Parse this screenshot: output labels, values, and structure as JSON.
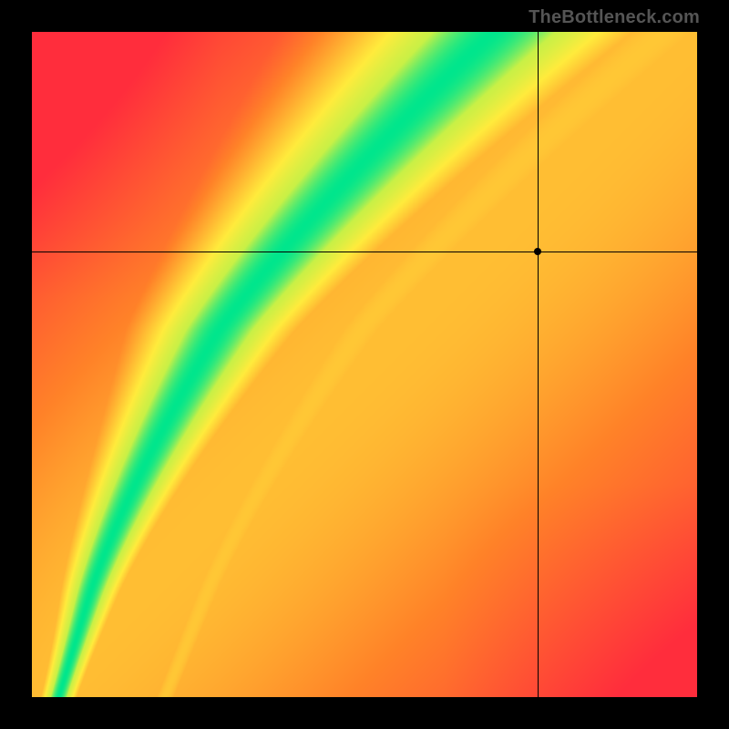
{
  "watermark": "TheBottleneck.com",
  "chart_data": {
    "type": "heatmap",
    "title": "",
    "xlabel": "",
    "ylabel": "",
    "xlim": [
      0,
      1
    ],
    "ylim": [
      0,
      1
    ],
    "grid": false,
    "legend_position": "none",
    "colormap_description": "Smooth nonlinear red→orange→yellow→green→yellow gradient; primary green ridge along a diagonal S-curve with a dimmer secondary yellow ridge below it",
    "crosshair": {
      "x": 0.76,
      "y": 0.67
    },
    "annotations": [
      {
        "text": "TheBottleneck.com",
        "position": "top-right"
      }
    ]
  }
}
